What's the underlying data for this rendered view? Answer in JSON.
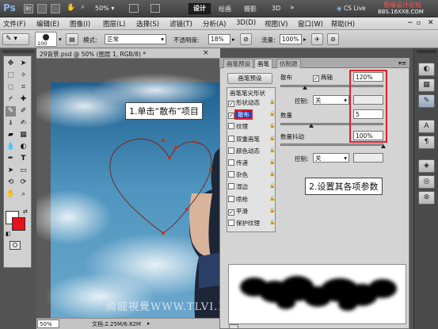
{
  "appbar": {
    "logo": "Ps",
    "zoom": "50%",
    "workspaces": [
      "设计",
      "绘画",
      "摄影",
      "3D"
    ],
    "more": "»",
    "cslive": "CS Live",
    "watermark_site": "思缘设计论坛",
    "watermark_url": "BBS.16XX8.COM"
  },
  "menu": [
    "文件(F)",
    "编辑(E)",
    "图像(I)",
    "图层(L)",
    "选择(S)",
    "滤镜(T)",
    "分析(A)",
    "3D(D)",
    "视图(V)",
    "窗口(W)",
    "帮助(H)"
  ],
  "options": {
    "brush_size": "100",
    "mode_label": "模式:",
    "mode_value": "正常",
    "opacity_label": "不透明度:",
    "opacity_value": "18%",
    "flow_label": "流量:",
    "flow_value": "100%"
  },
  "document": {
    "tab_title": "29背景.psd @ 50% (图层 1, RGB/8) *",
    "close": "×",
    "status_zoom": "50%",
    "status_doc": "文档:2.25M/6.82M"
  },
  "annotations": {
    "step1": "1.单击“散布”项目",
    "step2": "2.设置其各项参数",
    "watermark": "腾龍視覺WWW.TLVI.NET"
  },
  "brush_panel": {
    "tabs": [
      "画笔预设",
      "画笔",
      "仿制源"
    ],
    "active_tab": 1,
    "preset_button": "画笔预设",
    "tip_header": "画笔笔尖形状",
    "items": [
      {
        "label": "形状动态",
        "checked": true,
        "lock": true,
        "selected": false
      },
      {
        "label": "散布",
        "checked": true,
        "lock": true,
        "selected": true
      },
      {
        "label": "纹理",
        "checked": false,
        "lock": true,
        "selected": false
      },
      {
        "label": "双重画笔",
        "checked": false,
        "lock": true,
        "selected": false
      },
      {
        "label": "颜色动态",
        "checked": false,
        "lock": true,
        "selected": false
      },
      {
        "label": "传递",
        "checked": false,
        "lock": true,
        "selected": false
      },
      {
        "label": "杂色",
        "checked": false,
        "lock": true,
        "selected": false
      },
      {
        "label": "湿边",
        "checked": false,
        "lock": true,
        "selected": false
      },
      {
        "label": "喷枪",
        "checked": false,
        "lock": true,
        "selected": false
      },
      {
        "label": "平滑",
        "checked": true,
        "lock": true,
        "selected": false
      },
      {
        "label": "保护纹理",
        "checked": false,
        "lock": true,
        "selected": false
      }
    ],
    "scatter_label": "散布",
    "both_axes_label": "两轴",
    "scatter_value": "120%",
    "control_label": "控制:",
    "control_value": "关",
    "count_label": "数量",
    "count_value": "5",
    "count_jitter_label": "数量抖动",
    "count_jitter_value": "100%",
    "control2_value": "关",
    "scatter_pct": 0.24,
    "count_pct": 0.3,
    "jitter_pct": 1.0
  },
  "colors": {
    "foreground": "#ffffff",
    "background": "#e8101a",
    "highlight": "#e0202a",
    "selected_item": "#1a3fbf"
  }
}
